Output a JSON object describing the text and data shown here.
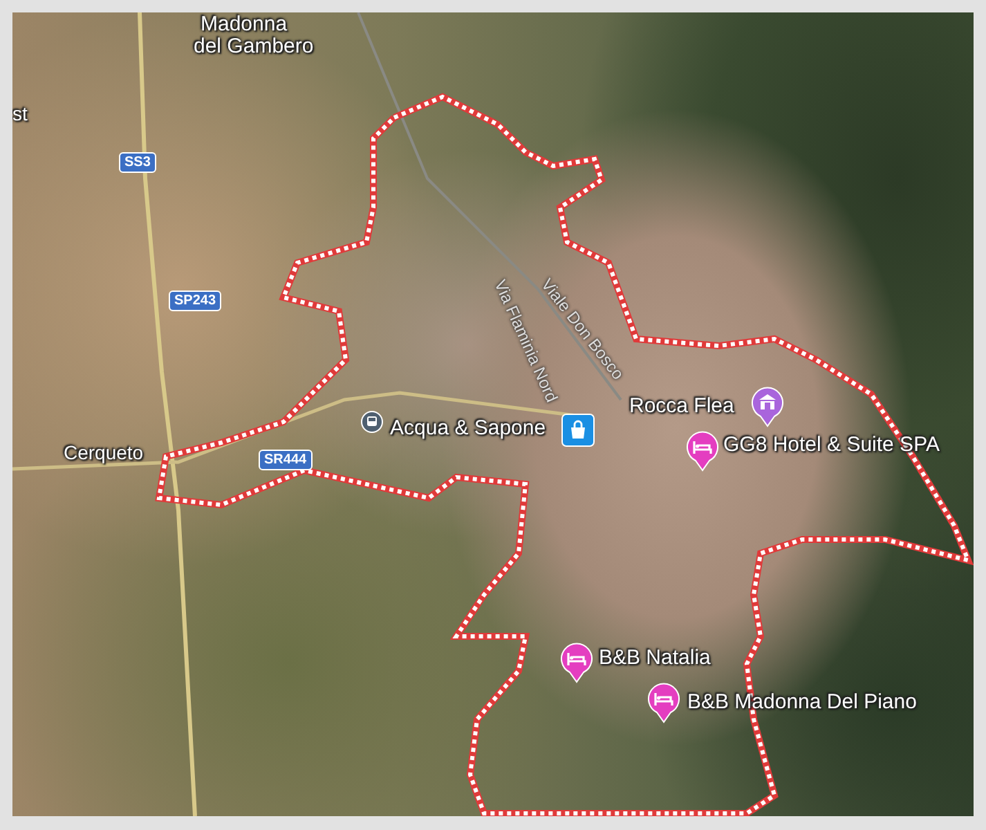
{
  "map": {
    "places": [
      {
        "label": "Madonna"
      },
      {
        "label": "del Gambero"
      },
      {
        "label": "st"
      },
      {
        "label": "Cerqueto"
      }
    ],
    "road_shields": [
      {
        "label": "SS3"
      },
      {
        "label": "SP243"
      },
      {
        "label": "SR444"
      }
    ],
    "streets": [
      {
        "label": "Via Flaminia Nord"
      },
      {
        "label": "Viale Don Bosco"
      }
    ],
    "pois": [
      {
        "kind": "train"
      },
      {
        "kind": "shop",
        "label": "Acqua & Sapone"
      },
      {
        "kind": "museum",
        "label": "Rocca Flea"
      },
      {
        "kind": "lodging",
        "label": "GG8 Hotel & Suite SPA"
      },
      {
        "kind": "lodging",
        "label": "B&B Natalia"
      },
      {
        "kind": "lodging",
        "label": "B&B Madonna Del Piano"
      }
    ]
  }
}
